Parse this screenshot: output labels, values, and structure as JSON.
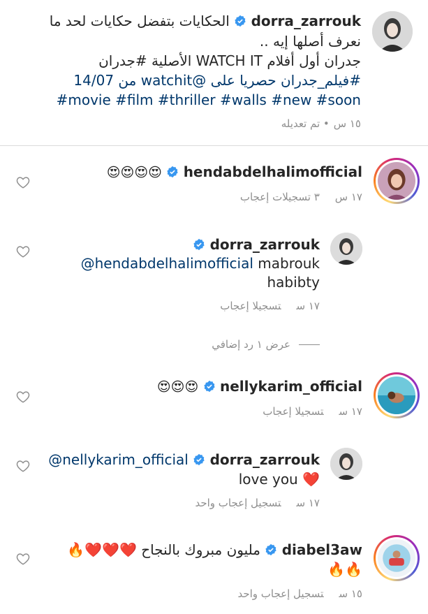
{
  "post": {
    "username": "dorra_zarrouk",
    "line1": "الحكايات بتفضل حكايات لحد ما",
    "line2": "نعرف أصلها إيه ..",
    "line3": "جدران أول أفلام WATCH IT الأصلية #جدران",
    "line4": "#فيلم_جدران حصريا على @watchit من 14/07",
    "line5": "#movie #film #thriller #walls #new #soon",
    "time": "١٥ س",
    "edited": "• تم تعديله"
  },
  "comments": [
    {
      "username": "hendabdelhalimofficial",
      "text": "😍😍😍😍",
      "time": "١٧ س",
      "likes": "٣ تسجيلات إعجاب"
    },
    {
      "username": "dorra_zarrouk",
      "mention": "@hendabdelhalimofficial",
      "text": "mabrouk",
      "text2": "habibty",
      "time": "١٧ س",
      "likes": "تسجيلا إعجاب"
    },
    {
      "view_replies": "عرض ١ رد إضافي"
    },
    {
      "username": "nellykarim_official",
      "text": "😍😍😍",
      "time": "١٧ س",
      "likes": "تسجيلا إعجاب"
    },
    {
      "username": "dorra_zarrouk",
      "mention": "@nellykarim_official",
      "text": "love you ❤️",
      "time": "١٧ س",
      "likes": "تسجيل إعجاب واحد"
    },
    {
      "username": "diabel3aw",
      "text": "مليون مبروك بالنجاح ❤️❤️❤️🔥",
      "text2": "🔥🔥",
      "time": "١٥ س",
      "likes": "تسجيل إعجاب واحد"
    }
  ],
  "icons": {
    "verified_color": "#3897f0",
    "heart": "heart-outline-icon"
  }
}
